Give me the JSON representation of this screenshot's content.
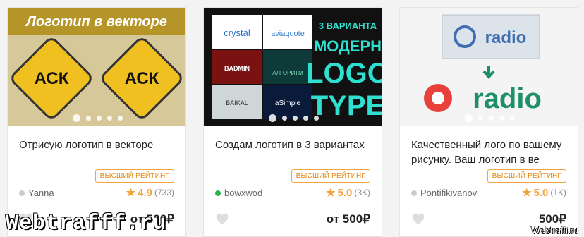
{
  "cards": [
    {
      "image_banner": "Логотип в векторе",
      "image_sign_text": "АСК",
      "title": "Отрисую логотип в векторе",
      "badge": "ВЫСШИЙ РЕЙТИНГ",
      "seller": "Yanna",
      "online": false,
      "rating": "4.9",
      "reviews": "(733)",
      "price": "от 500₽"
    },
    {
      "image_tiles": [
        "crystal",
        "aviaquote",
        "BADMIN",
        "АЛГОРИТМ",
        "BAIKAL",
        "aSimple"
      ],
      "image_heading": [
        "3 ВАРИАНТА",
        "МОДЕРН",
        "LOGO",
        "TYPE"
      ],
      "title": "Создам логотип в 3 вариантах",
      "badge": "ВЫСШИЙ РЕЙТИНГ",
      "seller": "bowxwod",
      "online": true,
      "rating": "5.0",
      "reviews": "(3K)",
      "price": "от 500₽"
    },
    {
      "image_logo_text": "radio",
      "title": "Качественный лого по вашему рисунку. Ваш логотип в ве",
      "badge": "ВЫСШИЙ РЕЙТИНГ",
      "seller": "Pontifikivanov",
      "online": false,
      "rating": "5.0",
      "reviews": "(1K)",
      "price": "500₽"
    }
  ],
  "watermark": {
    "big": "Webtrafff.ru",
    "small": "Webtraffi.ru"
  },
  "colors": {
    "accent_orange": "#f0a43c",
    "online_green": "#2bb24c",
    "radio_red": "#e8413b",
    "radio_green": "#1f8f6a"
  }
}
